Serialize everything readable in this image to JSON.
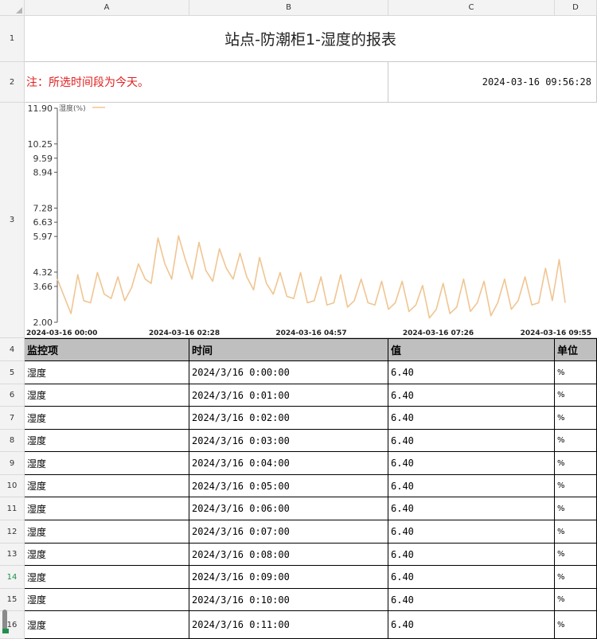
{
  "columns": [
    "A",
    "B",
    "C",
    "D"
  ],
  "row_numbers": [
    "1",
    "2",
    "3",
    "4",
    "5",
    "6",
    "7",
    "8",
    "9",
    "10",
    "11",
    "12",
    "13",
    "14",
    "15",
    "16"
  ],
  "active_row": "14",
  "title": "站点-防潮柜1-湿度的报表",
  "note": "注：所选时间段为今天。",
  "timestamp": "2024-03-16 09:56:28",
  "colors": {
    "note": "#e02020",
    "line": "#f0c592",
    "header_bg": "#bfbfbf",
    "active_row": "#1e8f4e"
  },
  "chart_data": {
    "type": "line",
    "legend": "湿度(%)",
    "legend_position": "top-left",
    "y_ticks": [
      "11.90",
      "10.25",
      "9.59",
      "8.94",
      "7.28",
      "6.63",
      "5.97",
      "4.32",
      "3.66",
      "2.00"
    ],
    "x_ticks": [
      "2024-03-16 00:00",
      "2024-03-16 02:28",
      "2024-03-16 04:57",
      "2024-03-16 07:26",
      "2024-03-16 09:55"
    ],
    "ylim": [
      2.0,
      11.9
    ],
    "x_range_minutes": [
      0,
      595
    ],
    "grid": false,
    "series": [
      {
        "name": "湿度(%)",
        "x_minutes": [
          0,
          8,
          16,
          24,
          31,
          39,
          47,
          55,
          63,
          71,
          79,
          87,
          95,
          103,
          110,
          118,
          126,
          134,
          142,
          150,
          158,
          166,
          174,
          182,
          190,
          198,
          206,
          214,
          222,
          230,
          237,
          245,
          253,
          261,
          269,
          277,
          285,
          293,
          301,
          309,
          316,
          324,
          332,
          340,
          348,
          356,
          364,
          372,
          380,
          388,
          396,
          404,
          412,
          420,
          428,
          436,
          444,
          452,
          460,
          468,
          476,
          484,
          492,
          500,
          508,
          516,
          524,
          532,
          540,
          548,
          556,
          564,
          572,
          580,
          588,
          595
        ],
        "values": [
          4.0,
          3.2,
          2.4,
          4.2,
          3.0,
          2.9,
          4.3,
          3.3,
          3.1,
          4.1,
          3.0,
          3.6,
          4.7,
          4.0,
          3.8,
          5.9,
          4.7,
          4.0,
          6.0,
          4.9,
          4.0,
          5.7,
          4.4,
          3.9,
          5.4,
          4.5,
          4.0,
          5.2,
          4.1,
          3.5,
          5.0,
          3.8,
          3.3,
          4.3,
          3.2,
          3.1,
          4.3,
          2.9,
          3.0,
          4.1,
          2.8,
          2.9,
          4.2,
          2.7,
          3.0,
          4.0,
          2.9,
          2.8,
          3.9,
          2.6,
          2.9,
          3.9,
          2.5,
          2.8,
          3.7,
          2.2,
          2.6,
          3.8,
          2.4,
          2.7,
          4.0,
          2.5,
          2.9,
          3.9,
          2.3,
          2.9,
          4.0,
          2.6,
          3.0,
          4.1,
          2.8,
          2.9,
          4.5,
          3.0,
          4.9,
          2.9
        ]
      }
    ]
  },
  "table": {
    "headers": [
      "监控项",
      "时间",
      "值",
      "单位"
    ],
    "rows": [
      [
        "湿度",
        "2024/3/16 0:00:00",
        "6.40",
        "%"
      ],
      [
        "湿度",
        "2024/3/16 0:01:00",
        "6.40",
        "%"
      ],
      [
        "湿度",
        "2024/3/16 0:02:00",
        "6.40",
        "%"
      ],
      [
        "湿度",
        "2024/3/16 0:03:00",
        "6.40",
        "%"
      ],
      [
        "湿度",
        "2024/3/16 0:04:00",
        "6.40",
        "%"
      ],
      [
        "湿度",
        "2024/3/16 0:05:00",
        "6.40",
        "%"
      ],
      [
        "湿度",
        "2024/3/16 0:06:00",
        "6.40",
        "%"
      ],
      [
        "湿度",
        "2024/3/16 0:07:00",
        "6.40",
        "%"
      ],
      [
        "湿度",
        "2024/3/16 0:08:00",
        "6.40",
        "%"
      ],
      [
        "湿度",
        "2024/3/16 0:09:00",
        "6.40",
        "%"
      ],
      [
        "湿度",
        "2024/3/16 0:10:00",
        "6.40",
        "%"
      ],
      [
        "湿度",
        "2024/3/16 0:11:00",
        "6.40",
        "%"
      ]
    ]
  }
}
